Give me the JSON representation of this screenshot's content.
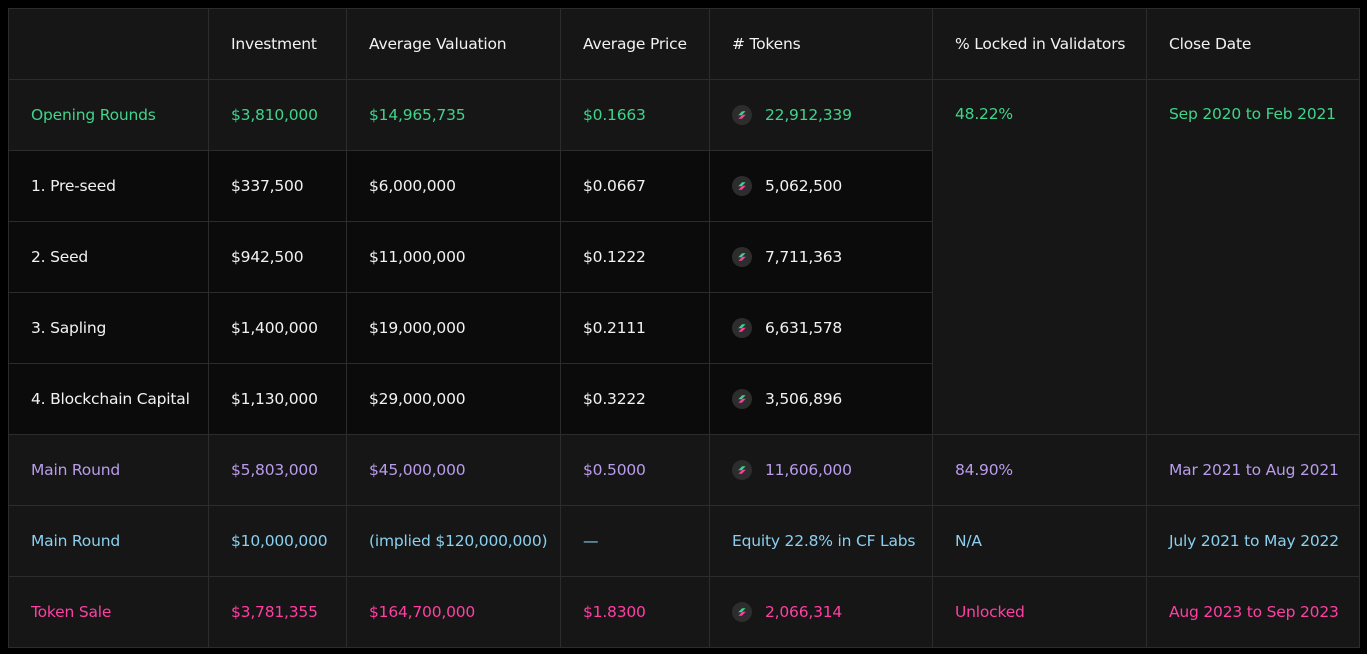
{
  "colors": {
    "opening": "#3fd48a",
    "main_purple": "#b99ceb",
    "main_blue": "#8ad0f0",
    "token_sale": "#ff3fa4",
    "text": "#f2f2f2",
    "coin_green": "#3fd48a",
    "coin_pink": "#ff3fa4"
  },
  "table": {
    "headers": [
      "",
      "Investment",
      "Average Valuation",
      "Average Price",
      "# Tokens",
      "% Locked in Validators",
      "Close Date"
    ],
    "opening_rounds": {
      "name": "Opening Rounds",
      "investment": "$3,810,000",
      "valuation": "$14,965,735",
      "price": "$0.1663",
      "tokens": "22,912,339",
      "locked": "48.22%",
      "close": "Sep 2020 to Feb 2021"
    },
    "sub_rounds": [
      {
        "name": "1. Pre-seed",
        "investment": "$337,500",
        "valuation": "$6,000,000",
        "price": "$0.0667",
        "tokens": "5,062,500"
      },
      {
        "name": "2. Seed",
        "investment": "$942,500",
        "valuation": "$11,000,000",
        "price": "$0.1222",
        "tokens": "7,711,363"
      },
      {
        "name": "3. Sapling",
        "investment": "$1,400,000",
        "valuation": "$19,000,000",
        "price": "$0.2111",
        "tokens": "6,631,578"
      },
      {
        "name": "4. Blockchain Capital",
        "investment": "$1,130,000",
        "valuation": "$29,000,000",
        "price": "$0.3222",
        "tokens": "3,506,896"
      }
    ],
    "main_round_tokens": {
      "name": "Main Round",
      "investment": "$5,803,000",
      "valuation": "$45,000,000",
      "price": "$0.5000",
      "tokens": "11,606,000",
      "locked": "84.90%",
      "close": "Mar 2021 to Aug 2021"
    },
    "main_round_equity": {
      "name": "Main Round",
      "investment": "$10,000,000",
      "valuation": "(implied $120,000,000)",
      "price": "—",
      "tokens": "Equity 22.8% in CF Labs",
      "locked": "N/A",
      "close": "July 2021 to May 2022"
    },
    "token_sale": {
      "name": "Token Sale",
      "investment": "$3,781,355",
      "valuation": "$164,700,000",
      "price": "$1.8300",
      "tokens": "2,066,314",
      "locked": "Unlocked",
      "close": "Aug 2023 to Sep 2023"
    }
  }
}
